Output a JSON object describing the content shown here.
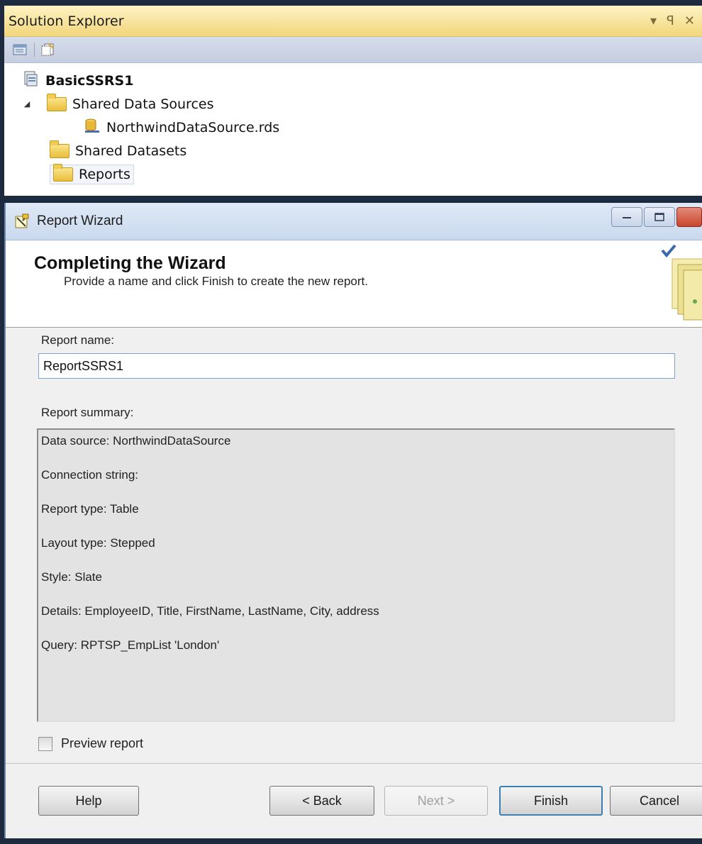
{
  "solution_explorer": {
    "title": "Solution Explorer",
    "controls": {
      "dropdown": "▾",
      "pin": "ꟼ",
      "close": "✕"
    },
    "project": "BasicSSRS1",
    "tree": {
      "shared_data_sources": "Shared Data Sources",
      "data_source_file": "NorthwindDataSource.rds",
      "shared_datasets": "Shared Datasets",
      "reports": "Reports"
    }
  },
  "wizard": {
    "title": "Report Wizard",
    "heading": "Completing the Wizard",
    "subheading": "Provide a name and click Finish to create the new report.",
    "report_name_label": "Report name:",
    "report_name_value": "ReportSSRS1",
    "summary_label": "Report summary:",
    "summary_lines": [
      "Data source: NorthwindDataSource",
      "Connection string:",
      "Report type: Table",
      "Layout type: Stepped",
      "Style: Slate",
      "Details: EmployeeID, Title, FirstName, LastName, City, address",
      "Query:  RPTSP_EmpList 'London'"
    ],
    "preview_label": "Preview report",
    "preview_checked": false,
    "buttons": {
      "help": "Help",
      "back": "< Back",
      "next": "Next >",
      "finish": "Finish",
      "cancel": "Cancel"
    }
  }
}
